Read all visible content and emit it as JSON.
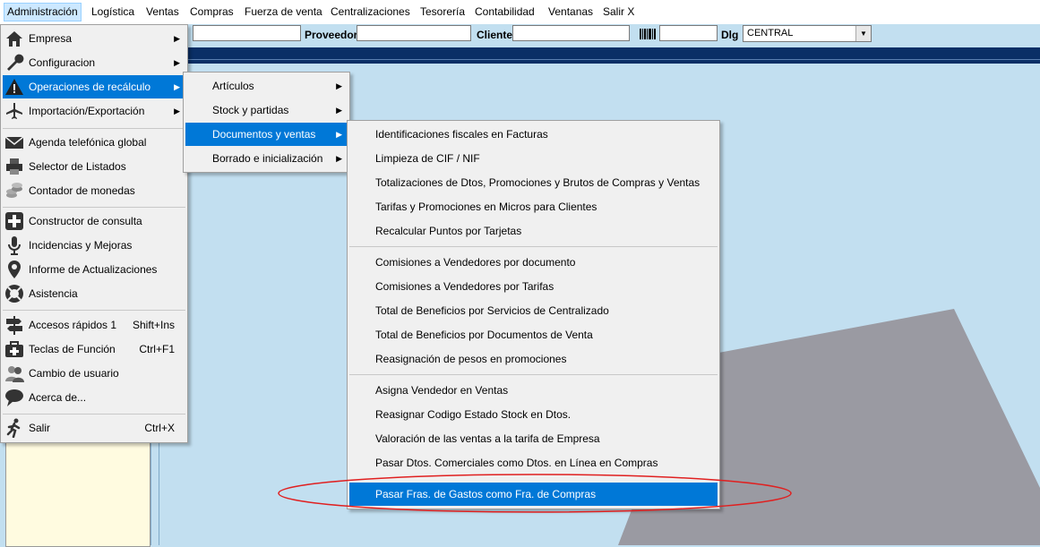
{
  "menubar": {
    "items": [
      "Administración",
      "Logística",
      "Ventas",
      "Compras",
      "Fuerza de venta",
      "Centralizaciones",
      "Tesorería",
      "Contabilidad",
      "Ventanas",
      "Salir X"
    ]
  },
  "toolbar": {
    "proveedor_label": "Proveedor",
    "cliente_label": "Cliente",
    "barcode_icon": "barcode-icon",
    "dlg_label": "Dlg",
    "dlg_value": "CENTRAL"
  },
  "admin_menu": {
    "items": [
      {
        "label": "Empresa",
        "icon": "home-icon",
        "shortcut": "",
        "submenu": true
      },
      {
        "label": "Configuracion",
        "icon": "wrench-icon",
        "shortcut": "",
        "submenu": true
      },
      {
        "label": "Operaciones de recálculo",
        "icon": "warning-icon",
        "shortcut": "",
        "submenu": true
      },
      {
        "label": "Importación/Exportación",
        "icon": "airplane-icon",
        "shortcut": "",
        "submenu": true
      },
      {
        "label": "Agenda telefónica global",
        "icon": "envelope-icon",
        "shortcut": "",
        "submenu": false
      },
      {
        "label": "Selector de Listados",
        "icon": "printer-icon",
        "shortcut": "",
        "submenu": false
      },
      {
        "label": "Contador de monedas",
        "icon": "coins-icon",
        "shortcut": "",
        "submenu": false
      },
      {
        "label": "Constructor de consulta",
        "icon": "plus-icon",
        "shortcut": "",
        "submenu": false
      },
      {
        "label": "Incidencias y Mejoras",
        "icon": "microphone-icon",
        "shortcut": "",
        "submenu": false
      },
      {
        "label": "Informe de Actualizaciones",
        "icon": "map-pin-icon",
        "shortcut": "",
        "submenu": false
      },
      {
        "label": "Asistencia",
        "icon": "lifebuoy-icon",
        "shortcut": "",
        "submenu": false
      },
      {
        "label": "Accesos rápidos 1",
        "icon": "signpost-icon",
        "shortcut": "Shift+Ins",
        "submenu": false
      },
      {
        "label": "Teclas de Función",
        "icon": "first-aid-icon",
        "shortcut": "Ctrl+F1",
        "submenu": false
      },
      {
        "label": "Cambio de usuario",
        "icon": "users-icon",
        "shortcut": "",
        "submenu": false
      },
      {
        "label": "Acerca de...",
        "icon": "speech-bubble-icon",
        "shortcut": "",
        "submenu": false
      },
      {
        "label": "Salir",
        "icon": "running-man-icon",
        "shortcut": "Ctrl+X",
        "submenu": false
      }
    ]
  },
  "recalc_menu": {
    "items": [
      "Artículos",
      "Stock y partidas",
      "Documentos y ventas",
      "Borrado e inicialización"
    ]
  },
  "docs_menu": {
    "items": [
      "Identificaciones fiscales en Facturas",
      "Limpieza de CIF / NIF",
      "Totalizaciones de Dtos, Promociones y Brutos de Compras y Ventas",
      "Tarifas y Promociones en Micros para Clientes",
      "Recalcular Puntos por Tarjetas",
      "Comisiones a Vendedores por documento",
      "Comisiones a Vendedores por Tarifas",
      "Total de Beneficios por Servicios de Centralizado",
      "Total de Beneficios por Documentos de Venta",
      "Reasignación de pesos en promociones",
      "Asigna Vendedor en Ventas",
      "Reasignar Codigo Estado Stock en Dtos.",
      "Valoración de las ventas a la tarifa de Empresa",
      "Pasar Dtos. Comerciales como Dtos. en Línea en Compras",
      "Pasar Fras. de Gastos como Fra. de Compras"
    ]
  },
  "colors": {
    "highlight": "#0078d7",
    "background": "#c2dff0",
    "annotation_circle": "#e02020"
  }
}
